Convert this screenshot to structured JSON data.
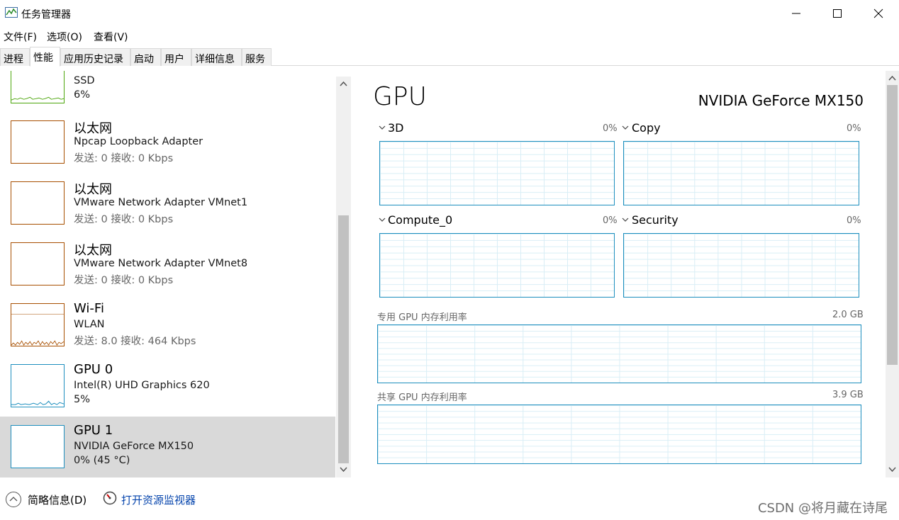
{
  "window": {
    "title": "任务管理器"
  },
  "menu": [
    "文件(F)",
    "选项(O)",
    "查看(V)"
  ],
  "tabs": [
    "进程",
    "性能",
    "应用历史记录",
    "启动",
    "用户",
    "详细信息",
    "服务"
  ],
  "active_tab": "性能",
  "devices": [
    {
      "name": "SSD",
      "line1": "6%",
      "line2": "",
      "color": "#4da60c"
    },
    {
      "name": "以太网",
      "line1": "Npcap Loopback Adapter",
      "line2_dim": "发送: 0 接收: 0 Kbps",
      "color": "#a74f01"
    },
    {
      "name": "以太网",
      "line1": "VMware Network Adapter VMnet1",
      "line2_dim": "发送: 0 接收: 0 Kbps",
      "color": "#a74f01"
    },
    {
      "name": "以太网",
      "line1": "VMware Network Adapter VMnet8",
      "line2_dim": "发送: 0 接收: 0 Kbps",
      "color": "#a74f01"
    },
    {
      "name": "Wi-Fi",
      "line1": "WLAN",
      "line2_dim": "发送: 8.0 接收: 464 Kbps",
      "color": "#a74f01"
    },
    {
      "name": "GPU 0",
      "line1": "Intel(R) UHD Graphics 620",
      "line2": "5%",
      "color": "#1e8fbe"
    },
    {
      "name": "GPU 1",
      "line1": "NVIDIA GeForce MX150",
      "line2": "0% (45 °C)",
      "color": "#1e8fbe"
    }
  ],
  "detail": {
    "title": "GPU",
    "gpu_name": "NVIDIA GeForce MX150",
    "engines": [
      {
        "label": "3D",
        "value": "0%"
      },
      {
        "label": "Copy",
        "value": "0%"
      },
      {
        "label": "Compute_0",
        "value": "0%"
      },
      {
        "label": "Security",
        "value": "0%"
      }
    ],
    "dedicated": {
      "label": "专用 GPU 内存利用率",
      "value": "2.0 GB"
    },
    "shared": {
      "label": "共享 GPU 内存利用率",
      "value": "3.9 GB"
    },
    "graph_color": "#1e8fbe"
  },
  "footer": {
    "fewer_details": "简略信息(D)",
    "resource_monitor": "打开资源监视器"
  },
  "watermark": "CSDN @将月藏在诗尾"
}
